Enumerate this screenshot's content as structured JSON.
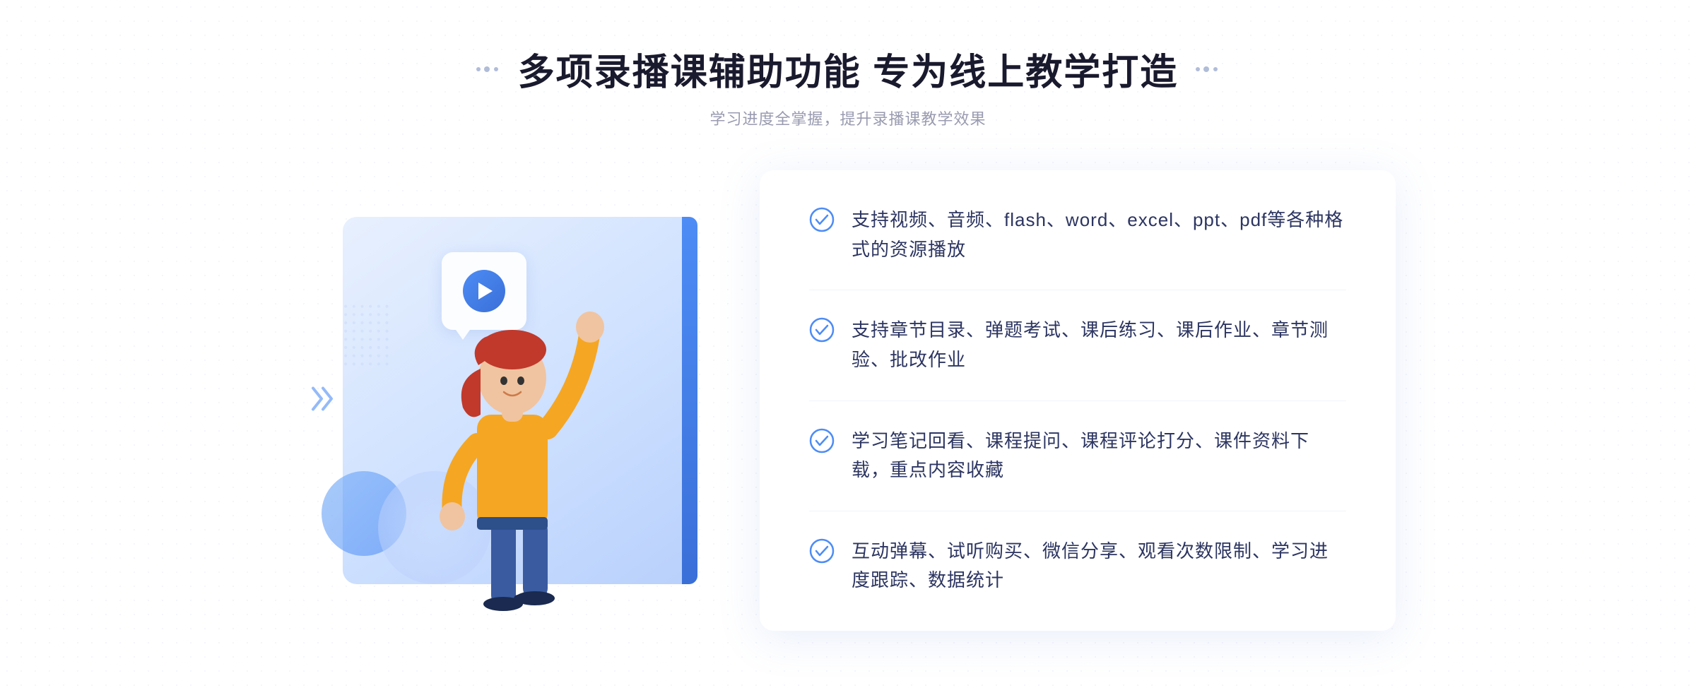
{
  "header": {
    "title": "多项录播课辅助功能 专为线上教学打造",
    "subtitle": "学习进度全掌握，提升录播课教学效果",
    "dots_left": [
      "•",
      "•",
      "•"
    ],
    "dots_right": [
      "•",
      "•",
      "•"
    ]
  },
  "features": [
    {
      "id": 1,
      "text": "支持视频、音频、flash、word、excel、ppt、pdf等各种格式的资源播放"
    },
    {
      "id": 2,
      "text": "支持章节目录、弹题考试、课后练习、课后作业、章节测验、批改作业"
    },
    {
      "id": 3,
      "text": "学习笔记回看、课程提问、课程评论打分、课件资料下载，重点内容收藏"
    },
    {
      "id": 4,
      "text": "互动弹幕、试听购买、微信分享、观看次数限制、学习进度跟踪、数据统计"
    }
  ],
  "icons": {
    "check": "check-circle-icon",
    "play": "play-icon",
    "chevron": "chevron-right-icon"
  },
  "colors": {
    "accent_blue": "#4d8cf5",
    "dark_blue": "#3a6fd8",
    "text_dark": "#2c3561",
    "text_gray": "#999bb0",
    "bg_light": "#f5f7ff"
  }
}
